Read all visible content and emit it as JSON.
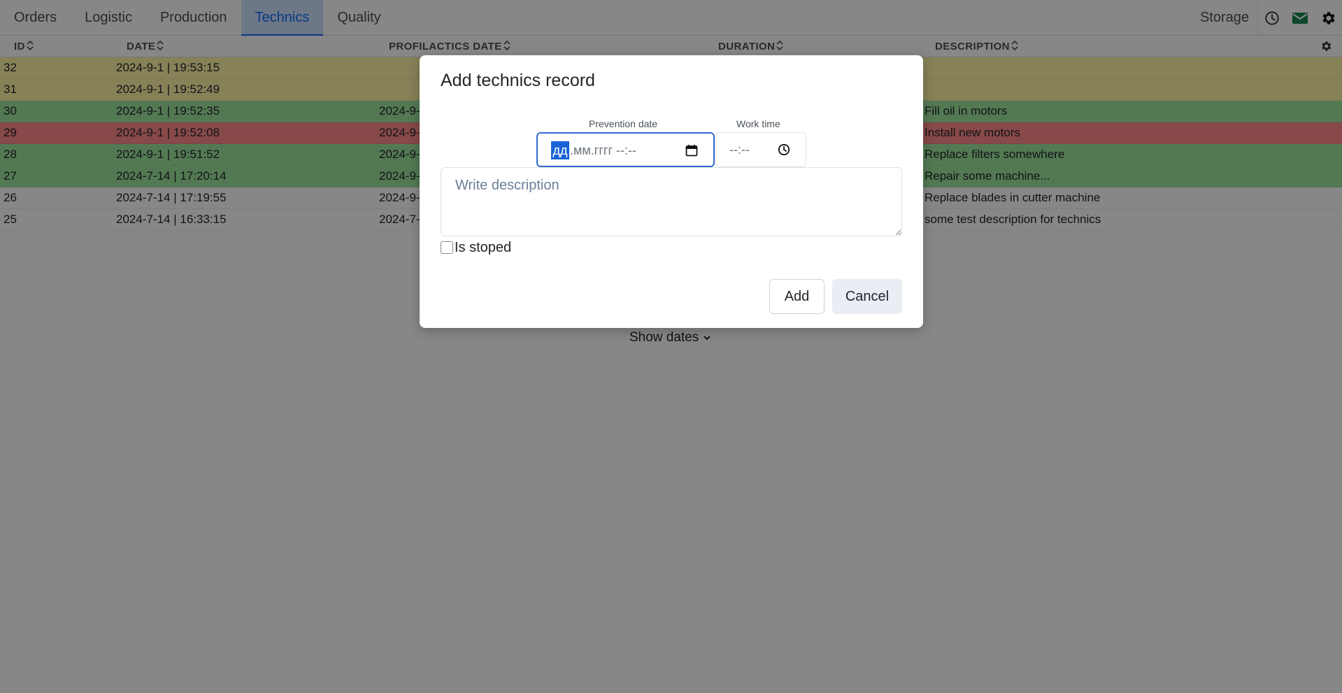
{
  "nav": {
    "tabs": [
      {
        "label": "Orders",
        "active": false
      },
      {
        "label": "Logistic",
        "active": false
      },
      {
        "label": "Production",
        "active": false
      },
      {
        "label": "Technics",
        "active": true
      },
      {
        "label": "Quality",
        "active": false
      }
    ],
    "storage_label": "Storage",
    "icons": [
      "clock-icon",
      "mail-icon",
      "gear-icon"
    ],
    "mail_count": "0"
  },
  "table": {
    "headers": [
      "ID",
      "DATE",
      "PROFILACTICS DATE",
      "DURATION",
      "DESCRIPTION"
    ],
    "rows": [
      {
        "id": "32",
        "date": "2024-9-1 | 19:53:15",
        "prof_date": "",
        "description": "",
        "color": "yellow"
      },
      {
        "id": "31",
        "date": "2024-9-1 | 19:52:49",
        "prof_date": "",
        "description": "",
        "color": "yellow"
      },
      {
        "id": "30",
        "date": "2024-9-1 | 19:52:35",
        "prof_date": "2024-9-",
        "description": "Fill oil in motors",
        "color": "green"
      },
      {
        "id": "29",
        "date": "2024-9-1 | 19:52:08",
        "prof_date": "2024-9-",
        "description": "Install new motors",
        "color": "red"
      },
      {
        "id": "28",
        "date": "2024-9-1 | 19:51:52",
        "prof_date": "2024-9-",
        "description": "Replace filters somewhere",
        "color": "green"
      },
      {
        "id": "27",
        "date": "2024-7-14 | 17:20:14",
        "prof_date": "2024-9-",
        "description": "Repair some machine...",
        "color": "green"
      },
      {
        "id": "26",
        "date": "2024-7-14 | 17:19:55",
        "prof_date": "2024-9-",
        "description": "Replace blades in cutter machine",
        "color": "white"
      },
      {
        "id": "25",
        "date": "2024-7-14 | 16:33:15",
        "prof_date": "2024-7-",
        "description": "some test description for technics",
        "color": "white"
      }
    ]
  },
  "show_dates_label": "Show dates",
  "modal": {
    "title": "Add technics record",
    "prevention_date_label": "Prevention date",
    "date_segment_selected": "дд",
    "date_rest": ".мм.гггг  --:--",
    "work_time_label": "Work time",
    "work_time_value": "--:--",
    "description_placeholder": "Write description",
    "is_stopped_label": "Is stoped",
    "is_stopped_checked": false,
    "add_label": "Add",
    "cancel_label": "Cancel"
  },
  "colors": {
    "row_yellow": "#fff3a6",
    "row_green": "#9ee59e",
    "row_red": "#ff8a8a",
    "accent": "#0d6efd",
    "mail_green": "#198754"
  }
}
